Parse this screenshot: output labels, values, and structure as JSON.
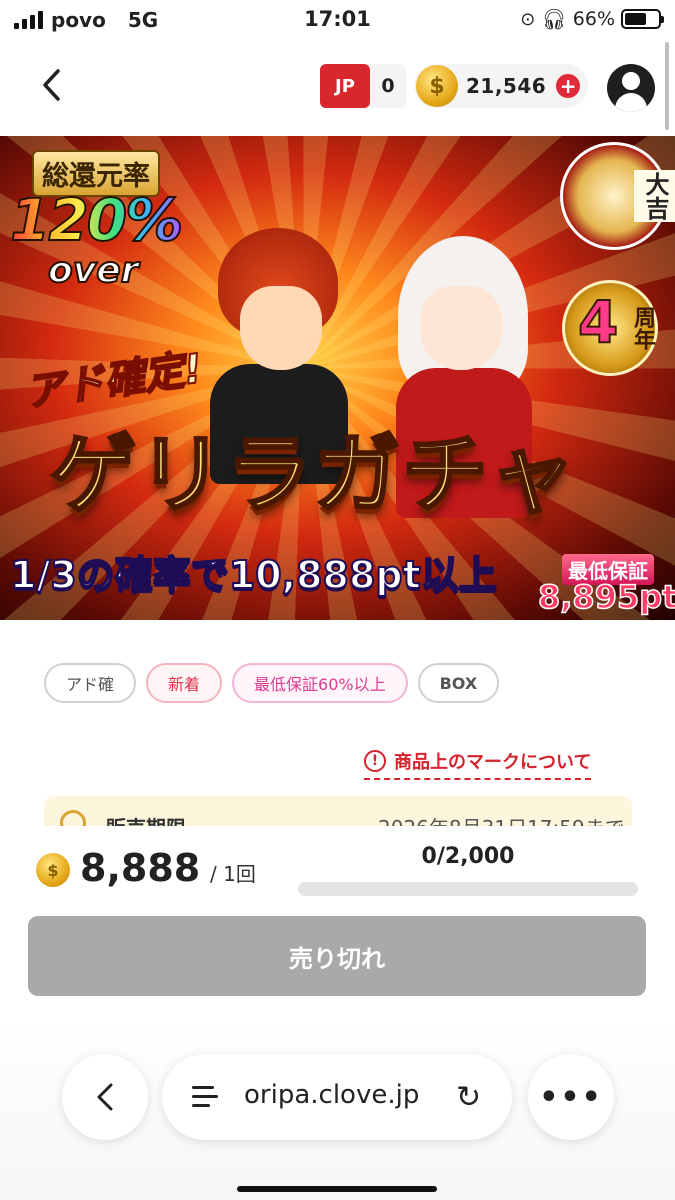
{
  "status_bar": {
    "carrier": "povo",
    "network": "5G",
    "time": "17:01",
    "battery_percent": "66%",
    "battery_level": 0.66
  },
  "header": {
    "back_icon": "chevron-left-icon",
    "jp_label": "JP",
    "jp_count": "0",
    "coin_icon": "coin-icon",
    "coin_balance": "21,546",
    "add_coin_label": "+",
    "profile_icon": "user-icon"
  },
  "banner": {
    "badge_label": "総還元率",
    "badge_percent": "120%",
    "badge_over": "over",
    "lucky_text": "大吉",
    "anniversary_number": "4",
    "anniversary_unit": "周年",
    "ad_label": "アド確定!",
    "title": "ゲリラガチャ",
    "subtitle": "1/3の確率で10,888pt以上",
    "min_guarantee_label": "最低保証",
    "min_guarantee_value": "8,895pt"
  },
  "tags": [
    {
      "label": "アド確"
    },
    {
      "label": "新着"
    },
    {
      "label": "最低保証60%以上"
    },
    {
      "label": "BOX"
    }
  ],
  "mark_link": {
    "icon": "alert-circle-icon",
    "label": "商品上のマークについて"
  },
  "sales_period": {
    "icon": "clock-icon",
    "label": "販売期限",
    "value": "2026年8月31日17:59まで"
  },
  "purchase": {
    "price": "8,888",
    "per_unit": "/ 1回",
    "stock_text": "0/2,000",
    "stock_fraction": 0,
    "button_label": "売り切れ"
  },
  "browser": {
    "back_icon": "chevron-left-icon",
    "tabs_icon": "tabs-icon",
    "url": "oripa.clove.jp",
    "reload_icon": "reload-icon",
    "more_icon": "more-icon",
    "more_label": "•••",
    "reload_label": "↻"
  }
}
